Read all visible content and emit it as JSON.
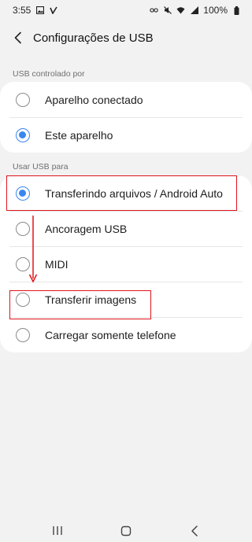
{
  "status_bar": {
    "time": "3:55",
    "battery": "100%",
    "left_icons": [
      "gallery-icon",
      "check-icon"
    ],
    "right_icons": [
      "key-icon",
      "mute-icon",
      "wifi-icon",
      "signal-icon",
      "battery-icon"
    ]
  },
  "header": {
    "title": "Configurações de USB"
  },
  "usb_controlled_by": {
    "label": "USB controlado por",
    "options": [
      {
        "label": "Aparelho conectado",
        "checked": false
      },
      {
        "label": "Este aparelho",
        "checked": true
      }
    ]
  },
  "usb_for": {
    "label": "Usar USB para",
    "options": [
      {
        "label": "Transferindo arquivos / Android Auto",
        "checked": true
      },
      {
        "label": "Ancoragem USB",
        "checked": false
      },
      {
        "label": "MIDI",
        "checked": false
      },
      {
        "label": "Transferir imagens",
        "checked": false
      },
      {
        "label": "Carregar somente telefone",
        "checked": false
      }
    ]
  },
  "annotation_color": "#e0141b",
  "accent_color": "#3a86f0",
  "nav_bar": [
    "recents-icon",
    "home-icon",
    "back-icon"
  ]
}
